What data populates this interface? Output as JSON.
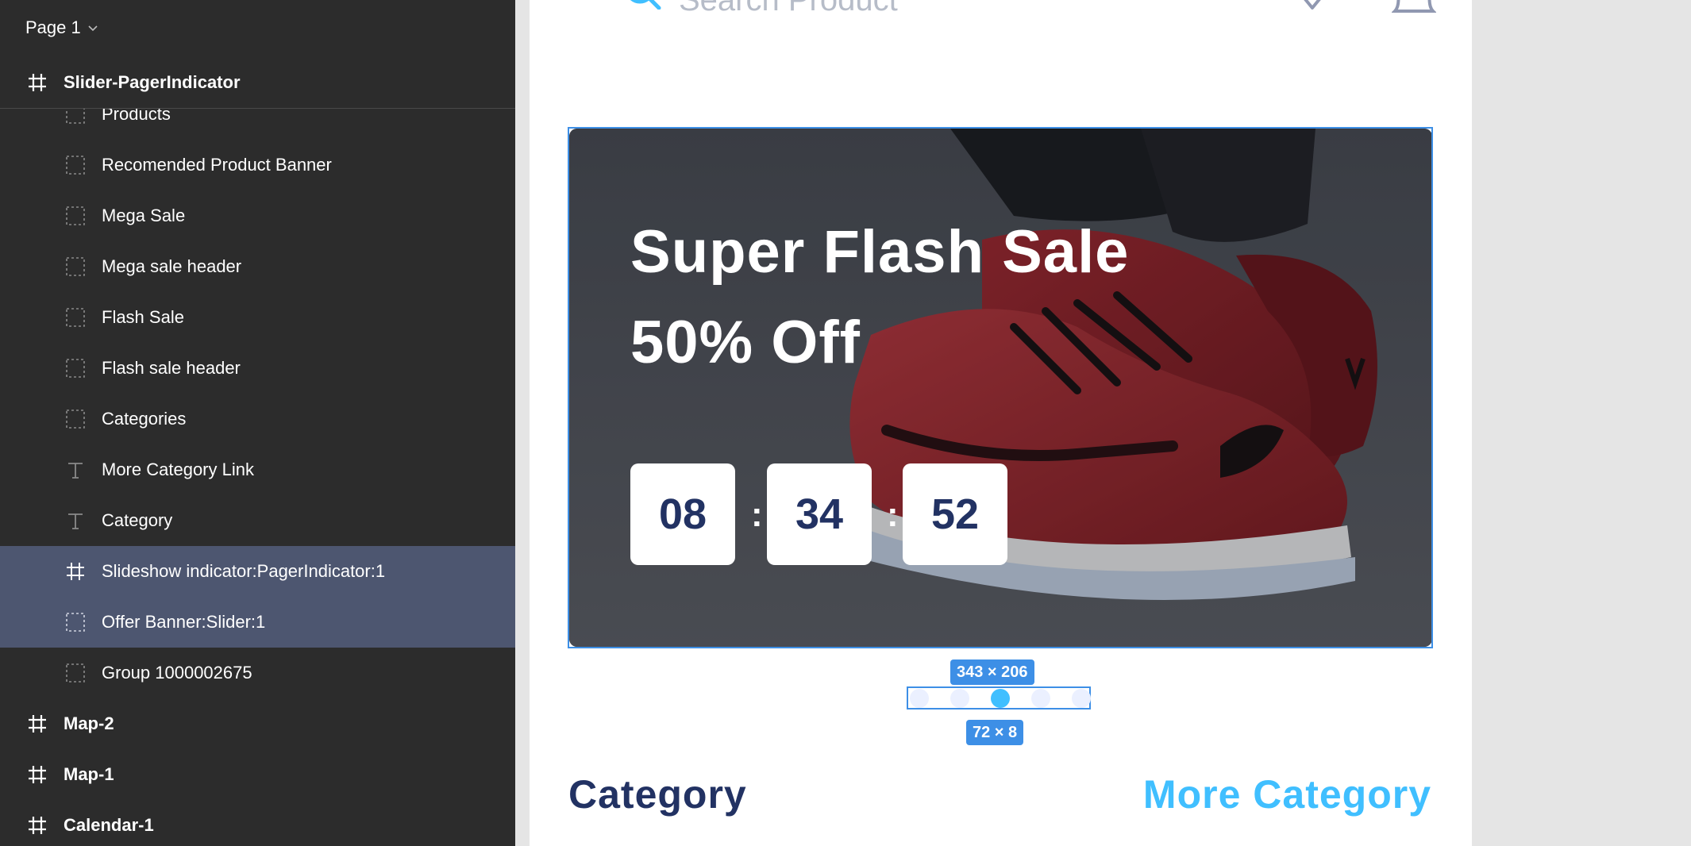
{
  "sidebar": {
    "page_selector": "Page 1",
    "root_frame": "Slider-PagerIndicator",
    "layers": [
      {
        "label": "Products",
        "kind": "group"
      },
      {
        "label": "Recomended Product Banner",
        "kind": "group"
      },
      {
        "label": "Mega Sale",
        "kind": "group"
      },
      {
        "label": "Mega sale header",
        "kind": "group"
      },
      {
        "label": "Flash Sale",
        "kind": "group"
      },
      {
        "label": "Flash sale header",
        "kind": "group"
      },
      {
        "label": "Categories",
        "kind": "group"
      },
      {
        "label": "More Category Link",
        "kind": "text"
      },
      {
        "label": "Category",
        "kind": "text"
      },
      {
        "label": "Slideshow indicator:PagerIndicator:1",
        "kind": "frame",
        "selected": true
      },
      {
        "label": "Offer Banner:Slider:1",
        "kind": "group",
        "selected": true
      },
      {
        "label": "Group 1000002675",
        "kind": "group"
      }
    ],
    "frames": [
      "Map-2",
      "Map-1",
      "Calendar-1"
    ]
  },
  "canvas": {
    "search_placeholder": "Search Product",
    "banner": {
      "title_line1": "Super Flash Sale",
      "title_line2": "50% Off",
      "timer": {
        "hours": "08",
        "minutes": "34",
        "seconds": "52",
        "separator": ":"
      }
    },
    "selection_size": "343 × 206",
    "pager_size": "72 × 8",
    "pager": {
      "count": 5,
      "active_index": 2
    },
    "category_title": "Category",
    "more_category": "More Category"
  },
  "colors": {
    "sidebar_bg": "#2c2c2c",
    "selected_row": "#4d5670",
    "selection_blue": "#3d8fe6",
    "primary_dark": "#223263",
    "accent_blue": "#40bfff",
    "dot_inactive": "#ebf0ff"
  },
  "icons": [
    "chevron-down-icon",
    "frame-hash-icon",
    "group-dashed-icon",
    "text-t-icon",
    "search-icon",
    "heart-icon",
    "bell-icon"
  ]
}
